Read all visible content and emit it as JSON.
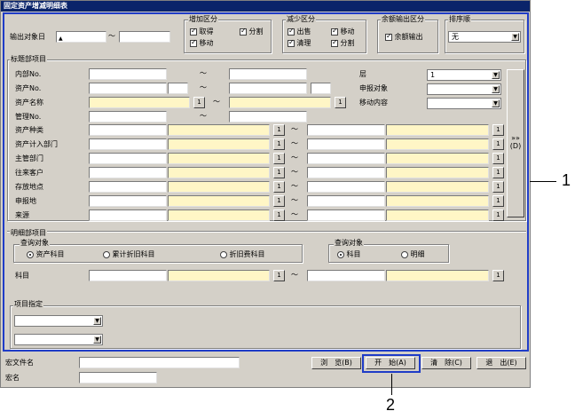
{
  "window": {
    "title": "固定资产增减明细表"
  },
  "header": {
    "output_date_label": "输出对象日",
    "tilde": "～",
    "increase": {
      "title": "增加区分",
      "get": "取得",
      "split": "分割",
      "move": "移动"
    },
    "decrease": {
      "title": "减少区分",
      "sell": "出售",
      "move": "移动",
      "clear": "清理",
      "split": "分割"
    },
    "balance": {
      "title": "余额输出区分",
      "option": "余额输出"
    },
    "order": {
      "title": "排序顺",
      "value": "无"
    }
  },
  "header_items": {
    "title": "标题部项目",
    "internal_no": "内部No.",
    "asset_no": "资产No.",
    "asset_name": "资产名称",
    "manage_no": "管理No.",
    "layer_label": "层",
    "layer_value": "1",
    "report_target": "申报对象",
    "move_content": "移动内容",
    "rows": [
      "资产种类",
      "资产计入部门",
      "主管部门",
      "往来客户",
      "存放地点",
      "申报地",
      "来源"
    ],
    "btn_small": "1",
    "expand_btn": "»»\n(D)"
  },
  "detail": {
    "title": "明细部项目",
    "query_target_left": "查询对象",
    "radio_asset": "资产科目",
    "radio_dep": "累计折旧科目",
    "radio_depexp": "折旧费科目",
    "query_target_right": "查询对象",
    "radio_subject": "科目",
    "radio_detail": "明细",
    "subject_label": "科目",
    "item_spec": "项目指定"
  },
  "footer": {
    "macro_file": "宏文件名",
    "macro_name": "宏名",
    "browse": "浏　览(B)",
    "start": "开　始(A)",
    "clear": "清　除(C)",
    "exit": "退　出(E)"
  },
  "callouts": {
    "one": "1",
    "two": "2"
  }
}
